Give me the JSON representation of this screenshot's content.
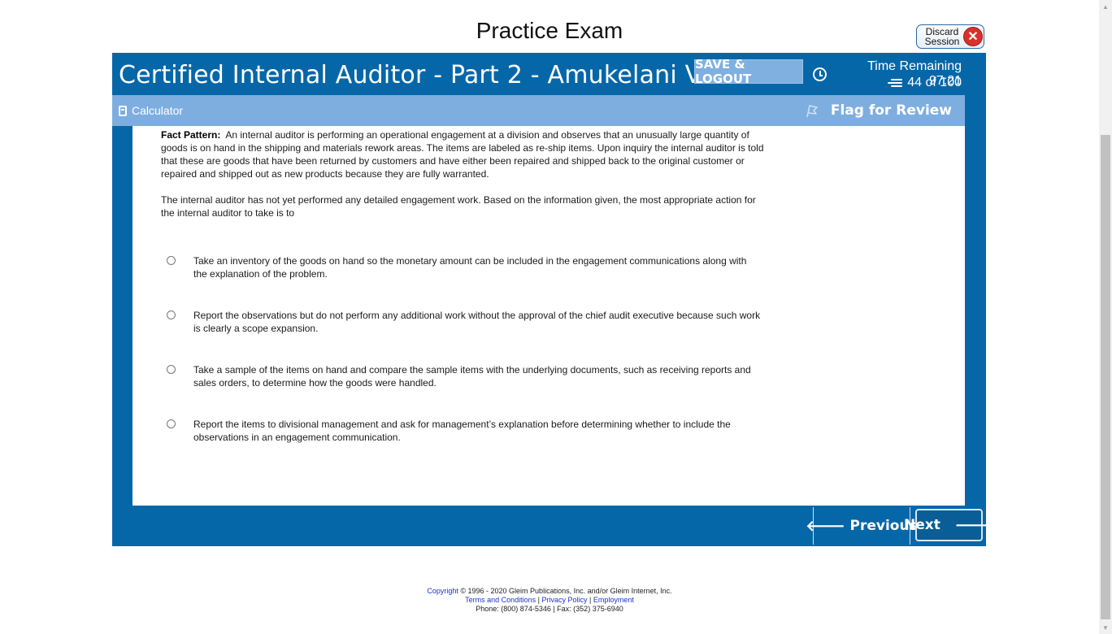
{
  "page": {
    "title": "Practice Exam"
  },
  "discard": {
    "label_line1": "Discard",
    "label_line2": "Session",
    "icon": "close-icon",
    "color": "#d9302c"
  },
  "header": {
    "exam_title": "Certified Internal Auditor - Part 2 - Amukelani Vukela",
    "save_label": "SAVE & LOGOUT",
    "time_label": "Time Remaining 97:21",
    "count_label": "44 of 100",
    "bg_color": "#0667a8"
  },
  "toolbar": {
    "calculator_label": "Calculator",
    "flag_label": "Flag for Review",
    "bg_color": "#7eaee0"
  },
  "question": {
    "fact_label": "Fact Pattern:",
    "fact_text": "An internal auditor is performing an operational engagement at a division and observes that an unusually large quantity of goods is on hand in the shipping and materials rework areas. The items are labeled as re-ship items. Upon inquiry the internal auditor is told that these are goods that have been returned by customers and have either been repaired and shipped back to the original customer or repaired and shipped out as new products because they are fully warranted.",
    "stem": "The internal auditor has not yet performed any detailed engagement work. Based on the information given, the most appropriate action for the internal auditor to take is to",
    "options": [
      {
        "text": "Take an inventory of the goods on hand so the monetary amount can be included in the engagement communications along with the explanation of the problem."
      },
      {
        "text": "Report the observations but do not perform any additional work without the approval of the chief audit executive because such work is clearly a scope expansion."
      },
      {
        "text": "Take a sample of the items on hand and compare the sample items with the underlying documents, such as receiving reports and sales orders, to determine how the goods were handled."
      },
      {
        "text": "Report the items to divisional management and ask for management’s explanation before determining whether to include the observations in an engagement communication."
      }
    ]
  },
  "navigation": {
    "previous_label": "Previous",
    "next_label": "Next"
  },
  "footer": {
    "copyright_link": "Copyright",
    "copyright_text": " © 1996 - 2020 Gleim Publications, Inc. and/or Gleim Internet, Inc.",
    "terms_link": "Terms and Conditions",
    "privacy_link": "Privacy Policy",
    "employment_link": "Employment",
    "separator": " | ",
    "phone_text": "Phone: (800) 874-5346 | Fax: (352) 375-6940"
  }
}
